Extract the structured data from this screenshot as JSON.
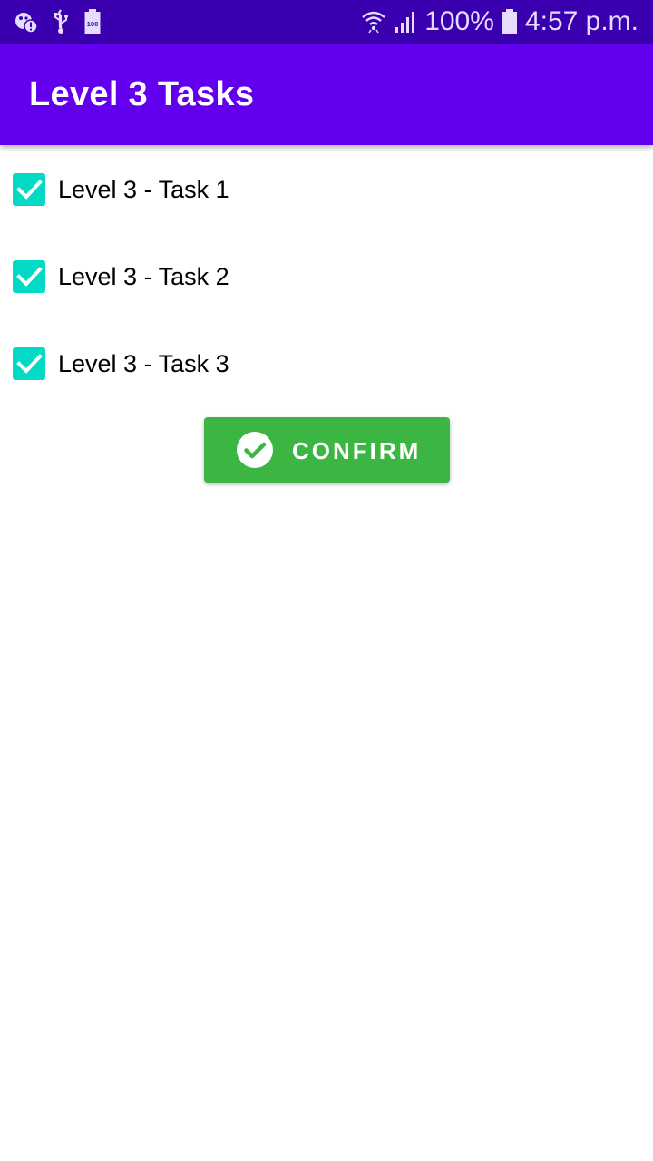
{
  "status_bar": {
    "battery_percent": "100%",
    "time": "4:57 p.m.",
    "left_icons": [
      "notification-alert-icon",
      "usb-icon",
      "battery-100-icon"
    ],
    "right_icons": [
      "wifi-icon",
      "signal-icon",
      "battery-icon"
    ]
  },
  "app_bar": {
    "title": "Level 3 Tasks"
  },
  "tasks": [
    {
      "label": "Level 3 - Task 1",
      "checked": true
    },
    {
      "label": "Level 3 - Task 2",
      "checked": true
    },
    {
      "label": "Level 3 - Task 3",
      "checked": true
    }
  ],
  "confirm_button": {
    "label": "CONFIRM",
    "icon": "check-circle-icon"
  },
  "colors": {
    "status_bar": "#3a00b0",
    "app_bar": "#6200ee",
    "checkbox": "#03dac5",
    "confirm_button": "#3bb643",
    "background": "#ffffff"
  },
  "left_status_icon_mini_text": "100"
}
